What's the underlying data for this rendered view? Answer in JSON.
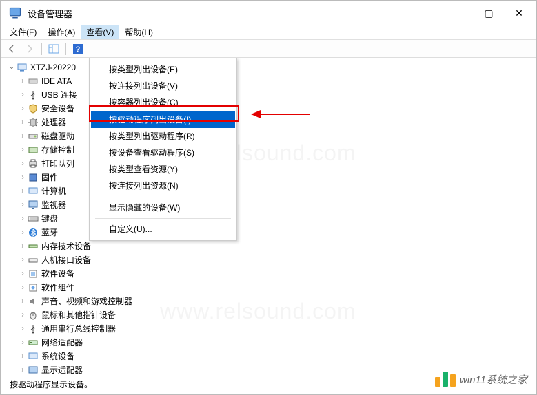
{
  "window": {
    "title": "设备管理器",
    "min": "—",
    "max": "▢",
    "close": "✕"
  },
  "menu": {
    "file": "文件(F)",
    "action": "操作(A)",
    "view": "查看(V)",
    "help": "帮助(H)"
  },
  "dropdown": {
    "byType": "按类型列出设备(E)",
    "byConnection": "按连接列出设备(V)",
    "byContainer": "按容器列出设备(C)",
    "byDriver": "按驱动程序列出设备(I)",
    "driversByType": "按类型列出驱动程序(R)",
    "driversByDevice": "按设备查看驱动程序(S)",
    "resourcesByType": "按类型查看资源(Y)",
    "resourcesByConn": "按连接列出资源(N)",
    "showHidden": "显示隐藏的设备(W)",
    "customize": "自定义(U)..."
  },
  "tree": {
    "root": "XTZJ-20220",
    "items": [
      "IDE ATA",
      "USB 连接",
      "安全设备",
      "处理器",
      "磁盘驱动",
      "存储控制",
      "打印队列",
      "固件",
      "计算机",
      "监视器",
      "键盘",
      "蓝牙",
      "内存技术设备",
      "人机接口设备",
      "软件设备",
      "软件组件",
      "声音、视频和游戏控制器",
      "鼠标和其他指针设备",
      "通用串行总线控制器",
      "网络适配器",
      "系统设备",
      "显示适配器"
    ]
  },
  "status": "按驱动程序显示设备。",
  "watermark": {
    "bgText": "www.relsound.com",
    "brandText": "win11系统之家"
  }
}
